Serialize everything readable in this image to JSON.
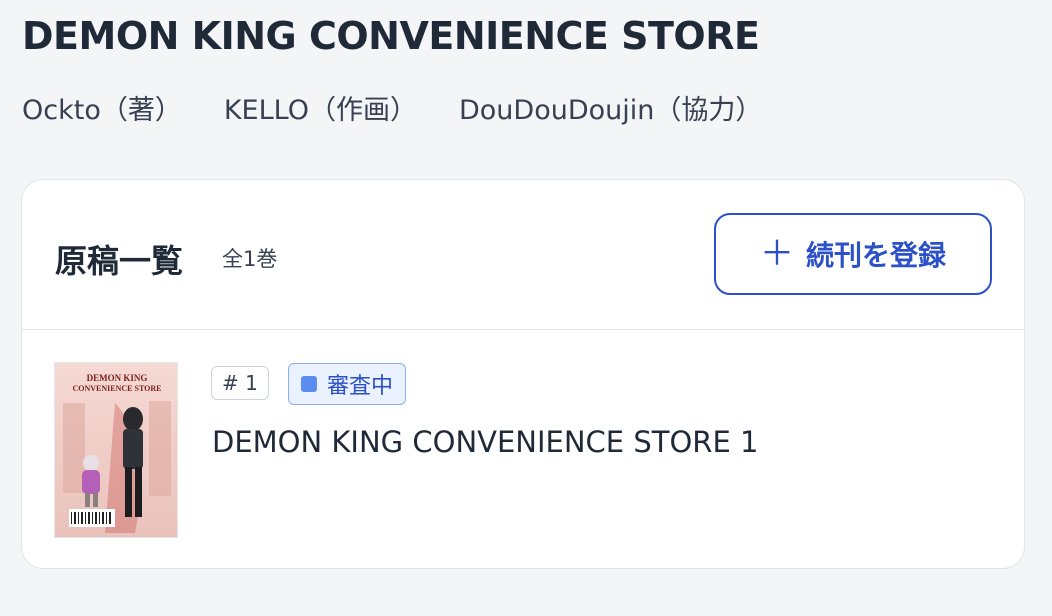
{
  "series": {
    "title": "DEMON KING CONVENIENCE STORE",
    "credits": [
      "Ockto（著）",
      "KELLO（作画）",
      "DouDouDoujin（協力）"
    ]
  },
  "manuscripts": {
    "heading": "原稿一覧",
    "count_label": "全1巻",
    "add_button": {
      "icon": "plus-icon",
      "label": "続刊を登録"
    },
    "volumes": [
      {
        "number_label": "# 1",
        "status": "審査中",
        "status_color": "#5b8def",
        "title": "DEMON KING CONVENIENCE STORE 1",
        "cover_logo_line1": "DEMON KING",
        "cover_logo_line2": "CONVENIENCE STORE"
      }
    ]
  },
  "colors": {
    "accent": "#2b50c8",
    "background": "#f4f5f7",
    "status_badge_bg": "#eaf1ff"
  }
}
